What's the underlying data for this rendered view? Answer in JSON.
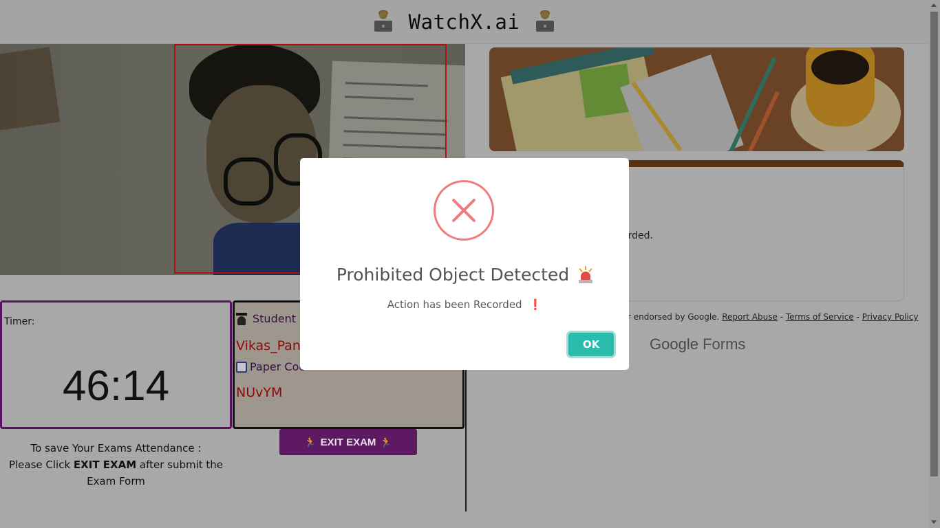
{
  "header": {
    "title": "WatchX.ai"
  },
  "timer": {
    "label": "Timer:",
    "value": "46:14"
  },
  "student": {
    "heading": "Student I",
    "name": "Vikas_Pand",
    "paper_label": "Paper Coc",
    "paper_code": "NUvYM"
  },
  "attendance": {
    "line1": "To save Your Exams Attendance :",
    "prefix": "Please Click ",
    "bold": "EXIT EXAM",
    "suffix": " after submit the Exam Form"
  },
  "exit_button": {
    "label": "EXIT EXAM"
  },
  "form": {
    "title_fragment": "c",
    "recorded_fragment": "orded.",
    "footer_text": "r endorsed by Google.",
    "report_abuse": "Report Abuse",
    "terms": "Terms of Service",
    "privacy": "Privacy Policy",
    "separator": " - ",
    "logo_google": "Google",
    "logo_forms": "Forms"
  },
  "modal": {
    "title": "Prohibited Object Detected",
    "message": "Action has been Recorded",
    "exclamation": "❗",
    "ok_label": "OK"
  },
  "colors": {
    "accent": "#2bbbad",
    "error": "#f07b7b",
    "exit_button": "#5d1a62",
    "detection_box": "#b01010"
  }
}
